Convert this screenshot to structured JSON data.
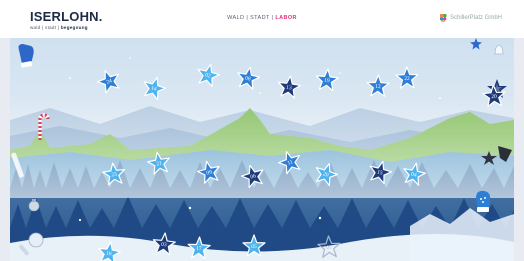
{
  "header": {
    "logo_title": "ISERLOHN",
    "logo_dot": ".",
    "logo_tagline_prefix": "wald | stadt | ",
    "logo_tagline_bold": "begegnung",
    "nav_left": "WALD | STADT | ",
    "nav_accent": "LABOR",
    "brand_right": "SchillerPlatz GmbH"
  },
  "colors": {
    "navy_star": "#1e3a7a",
    "blue_star": "#2f7fd6",
    "light_star": "#4fb3ee",
    "outline_star": "#a9b8cc"
  },
  "doors": [
    {
      "num": "24",
      "style": "blue"
    },
    {
      "num": "14",
      "style": "light"
    },
    {
      "num": "02",
      "style": "light"
    },
    {
      "num": "08",
      "style": "blue"
    },
    {
      "num": "13",
      "style": "navy"
    },
    {
      "num": "19",
      "style": "blue"
    },
    {
      "num": "12",
      "style": "blue"
    },
    {
      "num": "22",
      "style": "blue"
    },
    {
      "num": "20",
      "style": "navy"
    },
    {
      "num": "23",
      "style": "light"
    },
    {
      "num": "21",
      "style": "light"
    },
    {
      "num": "09",
      "style": "blue"
    },
    {
      "num": "06",
      "style": "navy"
    },
    {
      "num": "11",
      "style": "blue"
    },
    {
      "num": "20",
      "style": "light"
    },
    {
      "num": "15",
      "style": "navy"
    },
    {
      "num": "04",
      "style": "light"
    },
    {
      "num": "18",
      "style": "light"
    },
    {
      "num": "03",
      "style": "navy"
    },
    {
      "num": "17",
      "style": "light"
    },
    {
      "num": "05",
      "style": "light"
    },
    {
      "num": "07",
      "style": "outline"
    }
  ]
}
